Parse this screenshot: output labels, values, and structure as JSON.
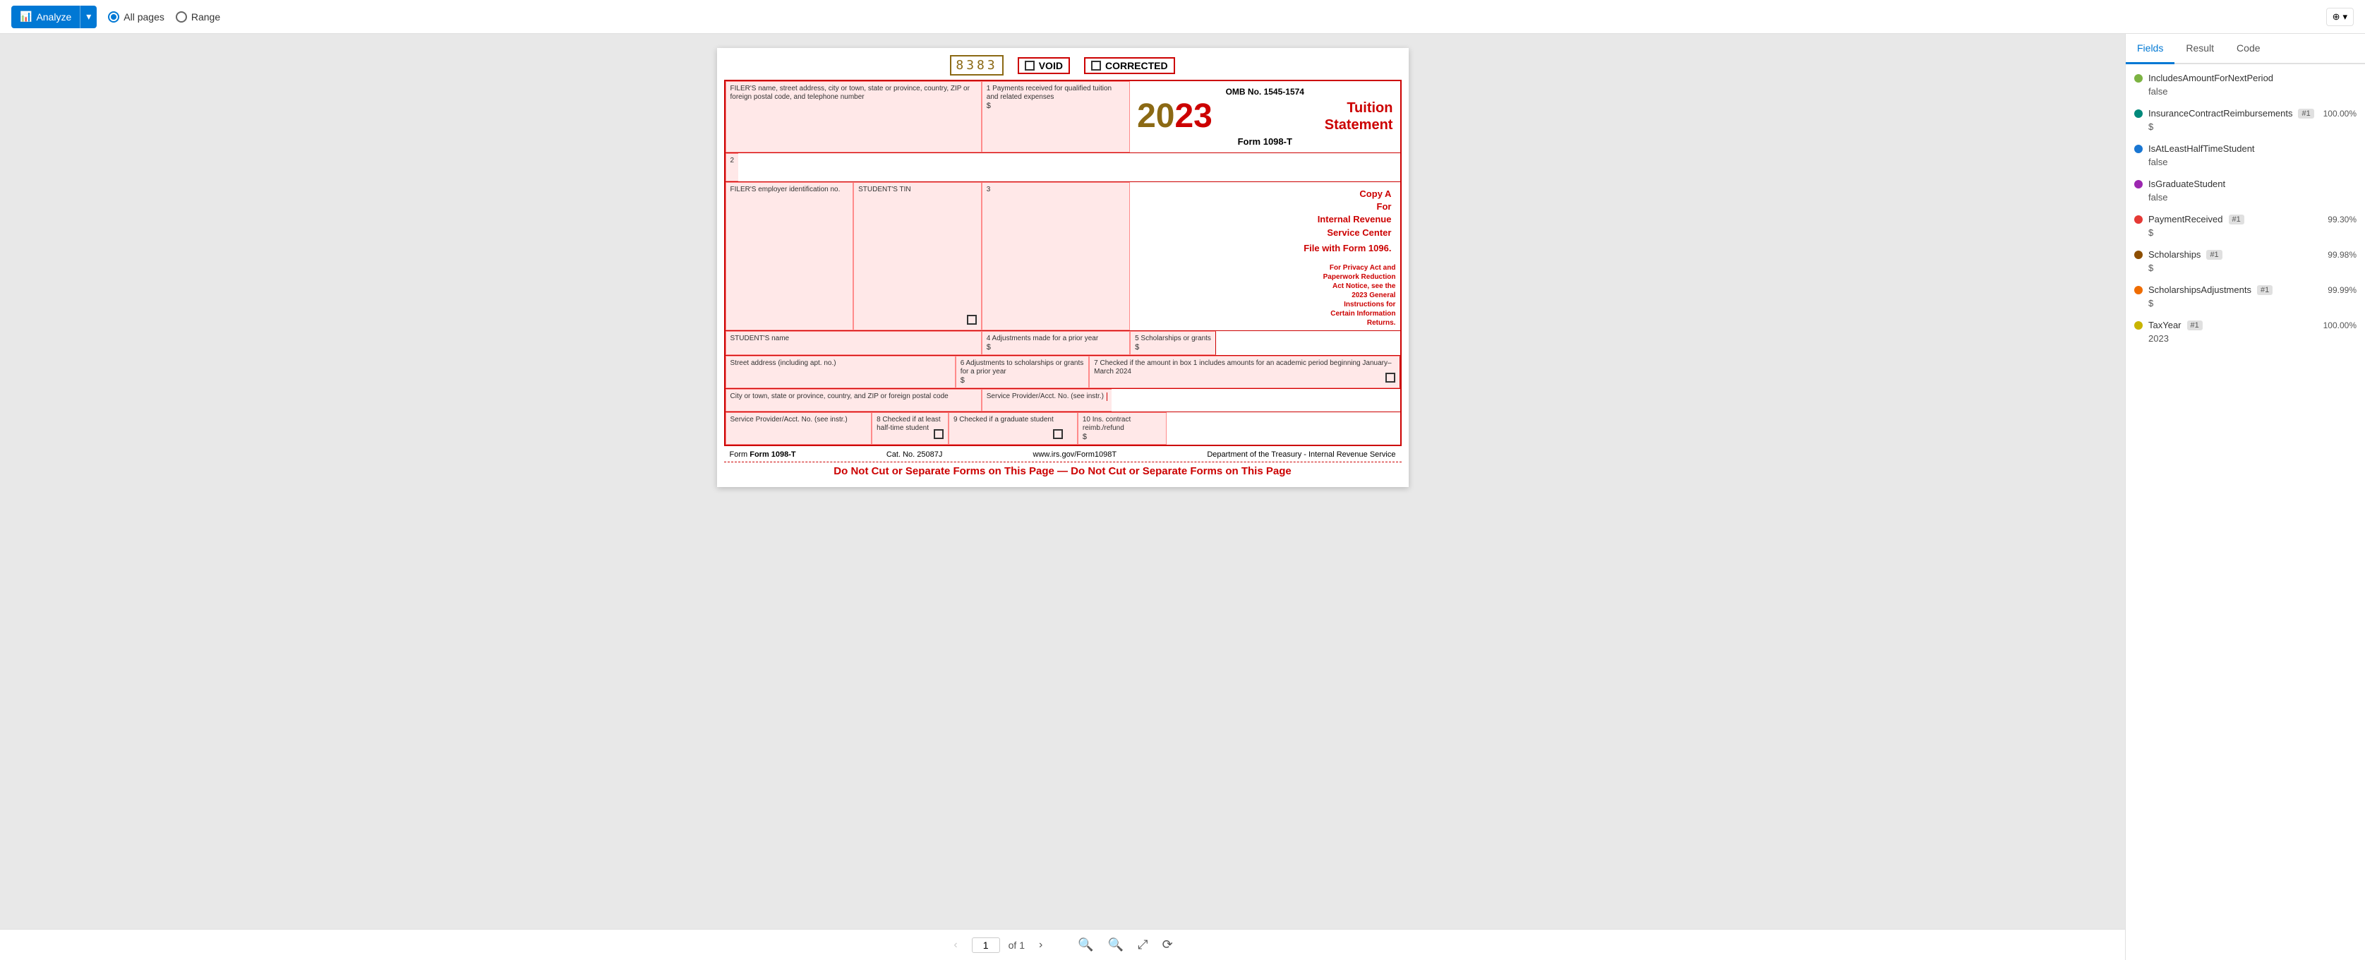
{
  "toolbar": {
    "analyze_label": "Analyze",
    "analyze_dropdown_icon": "▾",
    "all_pages_label": "All pages",
    "range_label": "Range",
    "layers_label": "⊕",
    "layers_dropdown": "▾"
  },
  "tabs": {
    "fields": "Fields",
    "result": "Result",
    "code": "Code",
    "active": "fields"
  },
  "navigation": {
    "prev_icon": "‹",
    "next_icon": "›",
    "current_page": "1",
    "page_of": "of 1",
    "zoom_in_icon": "+",
    "zoom_out_icon": "−",
    "rotate_icon": "⟳",
    "fit_icon": "⤢"
  },
  "form": {
    "barcode": "8383",
    "void_label": "VOID",
    "corrected_label": "CORRECTED",
    "omb_label": "OMB No. 1545-1574",
    "year": "2023",
    "form_title": "Tuition\nStatement",
    "form_name": "Form 1098-T",
    "copy_label": "Copy A",
    "copy_for": "For",
    "copy_dept": "Internal Revenue\nService Center",
    "file_with": "File with Form 1096.",
    "privacy_text": "For Privacy Act and\nPaperwork Reduction\nAct Notice, see the\n2023 General\nInstructions for\nCertain Information\nReturns.",
    "filer_name_label": "FILER'S name, street address, city or town, state or province, country, ZIP or\nforeign postal code, and telephone number",
    "box1_label": "1 Payments received for\nqualified tuition and related\nexpenses",
    "box2_label": "2",
    "box3_label": "3",
    "filer_ein_label": "FILER'S employer identification no.",
    "student_tin_label": "STUDENT'S TIN",
    "student_name_label": "STUDENT'S name",
    "box4_label": "4 Adjustments made for a\nprior year",
    "box5_label": "5 Scholarships or grants",
    "street_label": "Street address (including apt. no.)",
    "box6_label": "6 Adjustments to\nscholarships or grants\nfor a prior year",
    "box7_label": "7 Checked if the amount\nin box 1 includes\namounts for an\nacademic period\nbeginning January–\nMarch 2024",
    "city_label": "City or town, state or province, country, and ZIP or foreign postal code",
    "service_label": "Service Provider/Acct. No. (see instr.)",
    "box8_label": "8 Checked if at least\nhalf-time student",
    "box9_label": "9 Checked if a graduate\nstudent",
    "box10_label": "10 Ins. contract reimb./refund",
    "footer_form": "Form 1098-T",
    "footer_cat": "Cat. No. 25087J",
    "footer_url": "www.irs.gov/Form1098T",
    "footer_dept": "Department of the Treasury - Internal Revenue Service",
    "do_not_cut": "Do Not Cut or Separate Forms on This Page — Do Not Cut or Separate Forms on This Page"
  },
  "fields": [
    {
      "name": "IncludesAmountForNextPeriod",
      "color": "#7cb342",
      "dot_color": "#7cb342",
      "badge": null,
      "confidence": null,
      "value": "false"
    },
    {
      "name": "InsuranceContractReimbursements",
      "color": "#00695c",
      "dot_color": "#00897b",
      "badge": "#1",
      "confidence": "100.00%",
      "value": "$"
    },
    {
      "name": "IsAtLeastHalfTimeStudent",
      "color": "#1565c0",
      "dot_color": "#1976d2",
      "badge": null,
      "confidence": null,
      "value": "false"
    },
    {
      "name": "IsGraduateStudent",
      "color": "#7b1fa2",
      "dot_color": "#9c27b0",
      "badge": null,
      "confidence": null,
      "value": "false"
    },
    {
      "name": "PaymentReceived",
      "color": "#c62828",
      "dot_color": "#e53935",
      "badge": "#1",
      "confidence": "99.30%",
      "value": "$"
    },
    {
      "name": "Scholarships",
      "color": "#6d2b00",
      "dot_color": "#8d4e00",
      "badge": "#1",
      "confidence": "99.98%",
      "value": "$"
    },
    {
      "name": "ScholarshipsAdjustments",
      "color": "#e65100",
      "dot_color": "#ef6c00",
      "badge": "#1",
      "confidence": "99.99%",
      "value": "$"
    },
    {
      "name": "TaxYear",
      "color": "#b8a000",
      "dot_color": "#c8b400",
      "badge": "#1",
      "confidence": "100.00%",
      "value": "2023"
    }
  ]
}
